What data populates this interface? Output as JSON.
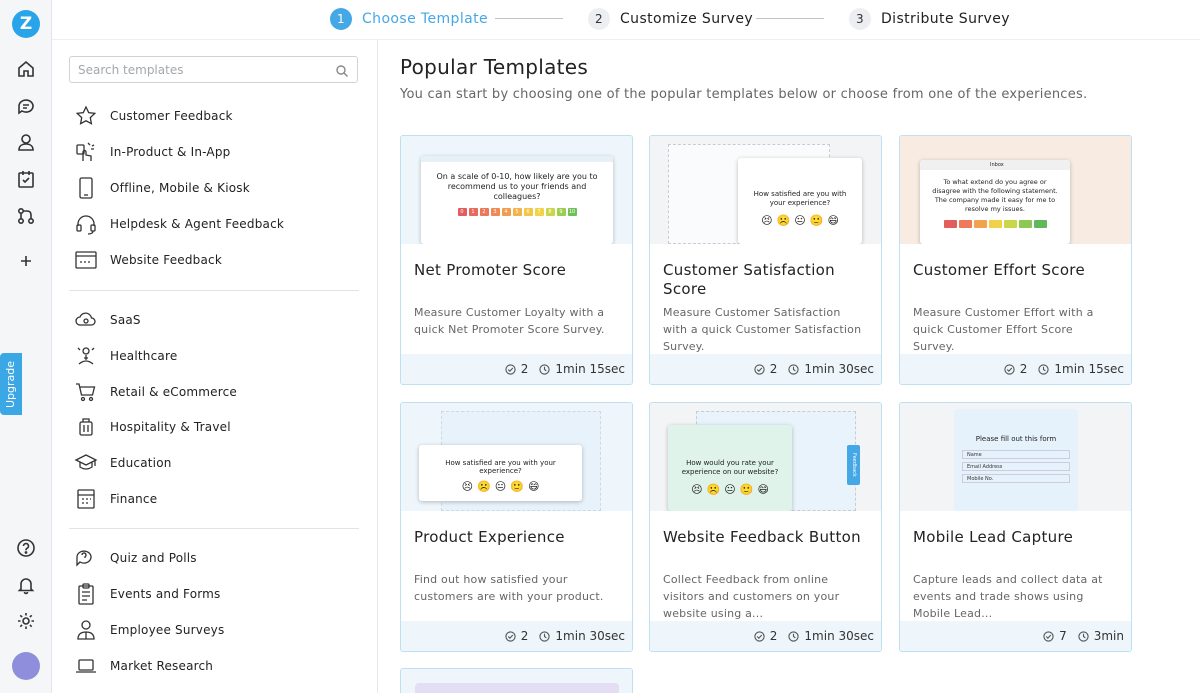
{
  "brand": {
    "logo": "Z",
    "accent": "#45a8e6"
  },
  "rail": {
    "icons": [
      "home-icon",
      "chat-icon",
      "user-icon",
      "survey-check-icon",
      "workflow-icon",
      "plus-icon",
      "help-icon",
      "bell-icon",
      "settings-icon"
    ],
    "upgrade_label": "Upgrade"
  },
  "stepper": {
    "steps": [
      {
        "num": "1",
        "label": "Choose Template",
        "active": true
      },
      {
        "num": "2",
        "label": "Customize Survey",
        "active": false
      },
      {
        "num": "3",
        "label": "Distribute Survey",
        "active": false
      }
    ]
  },
  "sidebar": {
    "search_placeholder": "Search templates",
    "groups": [
      [
        "Customer Feedback",
        "In-Product & In-App",
        "Offline, Mobile & Kiosk",
        "Helpdesk & Agent Feedback",
        "Website Feedback"
      ],
      [
        "SaaS",
        "Healthcare",
        "Retail & eCommerce",
        "Hospitality & Travel",
        "Education",
        "Finance"
      ],
      [
        "Quiz and Polls",
        "Events and Forms",
        "Employee Surveys",
        "Market Research"
      ]
    ]
  },
  "main": {
    "title": "Popular Templates",
    "subtitle": "You can start by choosing one of the popular templates below or choose from one of the experiences.",
    "cards": [
      {
        "name": "Net Promoter Score",
        "desc": "Measure Customer Loyalty with a quick Net Promoter Score Survey.",
        "questions": "2",
        "time": "1min 15sec",
        "preview": {
          "question": "On a scale of 0-10, how likely are you to recommend us to your friends and colleagues?",
          "scale": [
            "0",
            "1",
            "2",
            "3",
            "4",
            "5",
            "6",
            "7",
            "8",
            "9",
            "10"
          ]
        }
      },
      {
        "name": "Customer Satisfaction Score",
        "desc": "Measure Customer Satisfaction with a quick Customer Satisfaction Survey.",
        "questions": "2",
        "time": "1min 30sec",
        "preview": {
          "question": "How satisfied are you with your experience?"
        }
      },
      {
        "name": "Customer Effort Score",
        "desc": "Measure Customer Effort with a quick Customer Effort Score Survey.",
        "questions": "2",
        "time": "1min 15sec",
        "preview": {
          "question": "To what extend do you agree or disagree with the following statement. The company made it easy for me to resolve my issues.",
          "inbox": "Inbox"
        }
      },
      {
        "name": "Product Experience",
        "desc": "Find out how satisfied your customers are with your product.",
        "questions": "2",
        "time": "1min 30sec",
        "preview": {
          "question": "How satisfied are you with your experience?"
        }
      },
      {
        "name": "Website Feedback Button",
        "desc": "Collect Feedback from online visitors and customers on your website using a...",
        "questions": "2",
        "time": "1min 30sec",
        "preview": {
          "question": "How would you rate your experience on our website?",
          "tab": "Feedback"
        }
      },
      {
        "name": "Mobile Lead Capture",
        "desc": "Capture leads and collect data at events and trade shows using Mobile Lead...",
        "questions": "7",
        "time": "3min",
        "preview": {
          "question": "Please fill out this form",
          "fields": [
            "Name",
            "Email Address",
            "Mobile No."
          ]
        }
      }
    ]
  }
}
